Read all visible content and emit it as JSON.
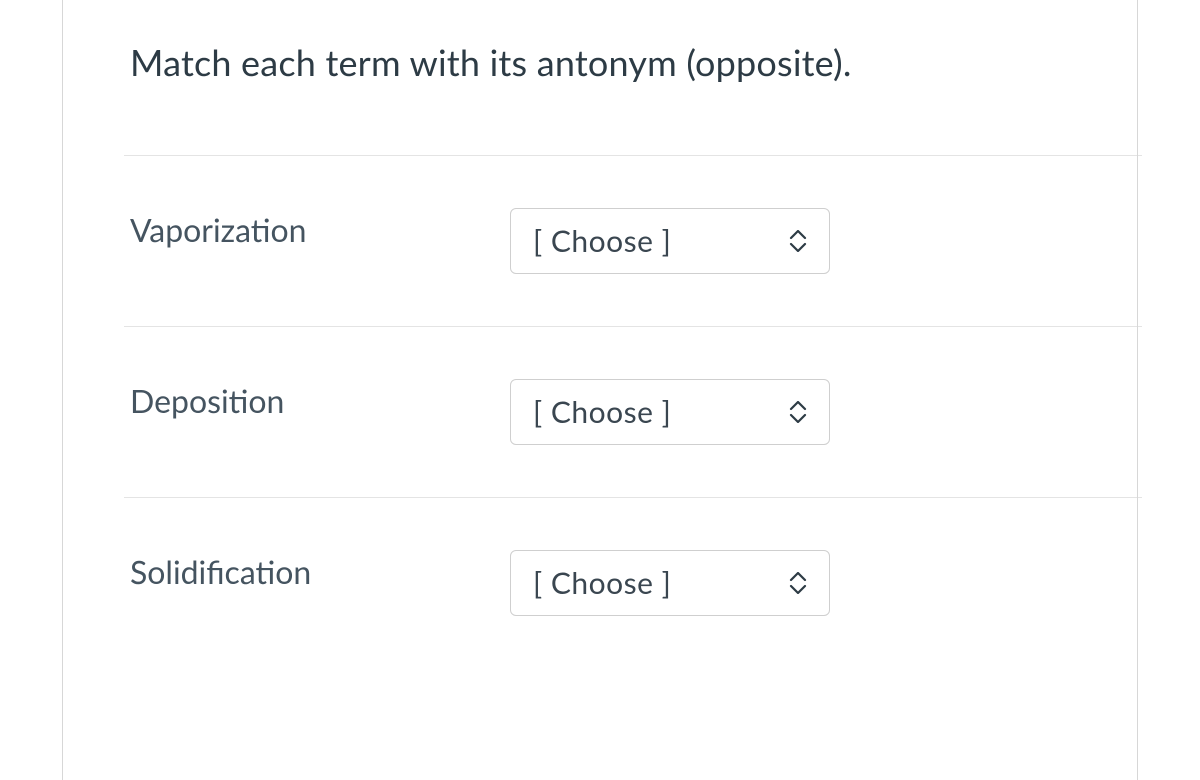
{
  "prompt": "Match each term with its antonym (opposite).",
  "placeholder": "[ Choose ]",
  "items": [
    {
      "term": "Vaporization"
    },
    {
      "term": "Deposition"
    },
    {
      "term": "Solidification"
    }
  ]
}
